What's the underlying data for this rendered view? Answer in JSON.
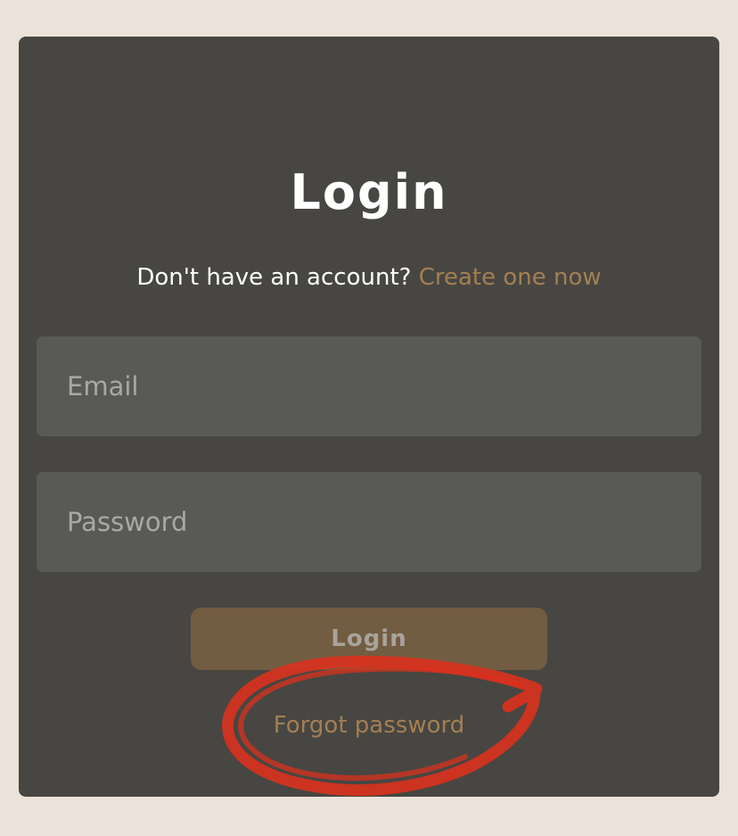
{
  "login": {
    "title": "Login",
    "signup_prompt": "Don't have an account? ",
    "signup_link": "Create one now",
    "email_placeholder": "Email",
    "password_placeholder": "Password",
    "login_button": "Login",
    "forgot_password": "Forgot password"
  },
  "colors": {
    "page_background": "#ebe2d9",
    "card_background": "#474642",
    "accent": "#a47f52",
    "button_background": "#725d42",
    "annotation": "#d8321e"
  }
}
